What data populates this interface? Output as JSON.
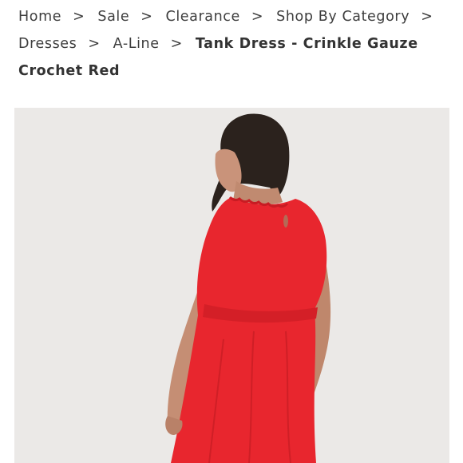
{
  "breadcrumb": {
    "items": [
      {
        "label": "Home"
      },
      {
        "label": "Sale"
      },
      {
        "label": "Clearance"
      },
      {
        "label": "Shop By Category"
      },
      {
        "label": "Dresses"
      },
      {
        "label": "A-Line"
      }
    ],
    "separator": ">",
    "current": "Tank Dress - Crinkle Gauze Crochet Red"
  },
  "product_image": {
    "background_color": "#ebe9e7",
    "dress_color": "#e8262e"
  }
}
